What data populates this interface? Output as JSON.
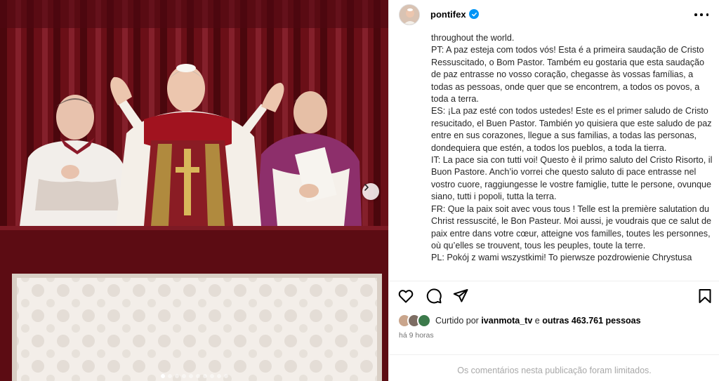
{
  "post": {
    "username": "pontifex",
    "caption_lines": [
      "throughout the world.",
      "PT: A paz esteja com todos vós! Esta é a primeira saudação de Cristo Ressuscitado, o Bom Pastor. Também eu gostaria que esta saudação de paz entrasse no vosso coração, chegasse às vossas famílias, a todas as pessoas, onde quer que se encontrem, a todos os povos, a toda a terra.",
      "ES: ¡La paz esté con todos ustedes! Este es el primer saludo de Cristo resucitado, el Buen Pastor. También yo quisiera que este saludo de paz entre en sus corazones, llegue a sus familias, a todas las personas, dondequiera que estén, a todos los pueblos, a toda la tierra.",
      "IT: La pace sia con tutti voi! Questo è il primo saluto del Cristo Risorto, il Buon Pastore. Anch’io vorrei che questo saluto di pace entrasse nel vostro cuore, raggiungesse le vostre famiglie, tutte le persone, ovunque siano, tutti i popoli, tutta la terra.",
      "FR: Que la paix soit avec vous tous ! Telle est la première salutation du Christ ressuscité, le Bon Pasteur. Moi aussi, je voudrais que ce salut de paix entre dans votre cœur, atteigne vos familles, toutes les personnes, où qu’elles se trouvent, tous les peuples, toute la terre.",
      "PL: Pokój z wami wszystkimi! To pierwsze pozdrowienie Chrystusa"
    ],
    "likes_prefix": "Curtido por",
    "liker": "ivanmota_tv",
    "likes_connector": "e",
    "likes_count_text": "outras 463.761 pessoas",
    "time_ago": "há 9 horas",
    "comments_limited": "Os comentários nesta publicação foram limitados."
  },
  "carousel": {
    "total_slides": 10,
    "active_slide": 1
  },
  "icons": {
    "like": "heart-icon",
    "comment": "comment-icon",
    "share": "send-icon",
    "save": "bookmark-icon",
    "next": "chevron-right-icon",
    "more": "more-horizontal-icon",
    "verified": "verified-badge-icon"
  },
  "colors": {
    "verified": "#0095f6",
    "muted": "#737373",
    "comments_disabled": "#a8a8a8",
    "curtain": "#6b0f18"
  }
}
